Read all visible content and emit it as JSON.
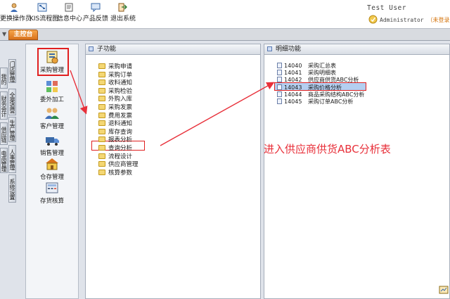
{
  "toolbar": {
    "buttons": [
      {
        "label": "更换操作员",
        "icon": "user-switch-icon"
      },
      {
        "label": "KIS流程图",
        "icon": "flowchart-icon"
      },
      {
        "label": "信息中心",
        "icon": "info-center-icon"
      },
      {
        "label": "产品反馈",
        "icon": "feedback-icon"
      },
      {
        "label": "退出系统",
        "icon": "exit-icon"
      }
    ]
  },
  "user": {
    "name": "Test User",
    "role": "Administrator",
    "status": "（未登录）"
  },
  "tabs": {
    "main": "主控台"
  },
  "vertical_tabs": [
    "门店管理",
    "我的KIS",
    "全渠道营销",
    "财务会计",
    "供应链",
    "生产管理",
    "电商管理",
    "人事管理",
    "系统设置"
  ],
  "modules": [
    {
      "label": "采购管理",
      "icon": "purchase-management-icon"
    },
    {
      "label": "委外加工",
      "icon": "outsourcing-icon"
    },
    {
      "label": "客户管理",
      "icon": "customer-management-icon"
    },
    {
      "label": "销售管理",
      "icon": "sales-management-icon"
    },
    {
      "label": "仓存管理",
      "icon": "warehouse-icon"
    },
    {
      "label": "存货核算",
      "icon": "inventory-accounting-icon"
    }
  ],
  "sub_panel": {
    "title": "子功能",
    "items": [
      "采购申请",
      "采购订单",
      "收料通知",
      "采购检验",
      "外购入库",
      "采购发票",
      "费用发票",
      "退料通知",
      "库存查询",
      "报表分析",
      "查询分析",
      "流程设计",
      "供应商管理",
      "核算参数"
    ]
  },
  "detail_panel": {
    "title": "明细功能",
    "items": [
      {
        "code": "14040",
        "label": "采购汇总表"
      },
      {
        "code": "14041",
        "label": "采购明细表"
      },
      {
        "code": "14042",
        "label": "供应商供货ABC分析"
      },
      {
        "code": "14043",
        "label": "采购价格分析"
      },
      {
        "code": "14044",
        "label": "商品采购结构ABC分析"
      },
      {
        "code": "14045",
        "label": "采购订单ABC分析"
      }
    ]
  },
  "annotation": "进入供应商供货ABC分析表",
  "colors": {
    "highlight_red": "#e02020",
    "annotation_red": "#e8303a",
    "tab_orange": "#e8871f",
    "selection_blue": "#b4cff1"
  }
}
